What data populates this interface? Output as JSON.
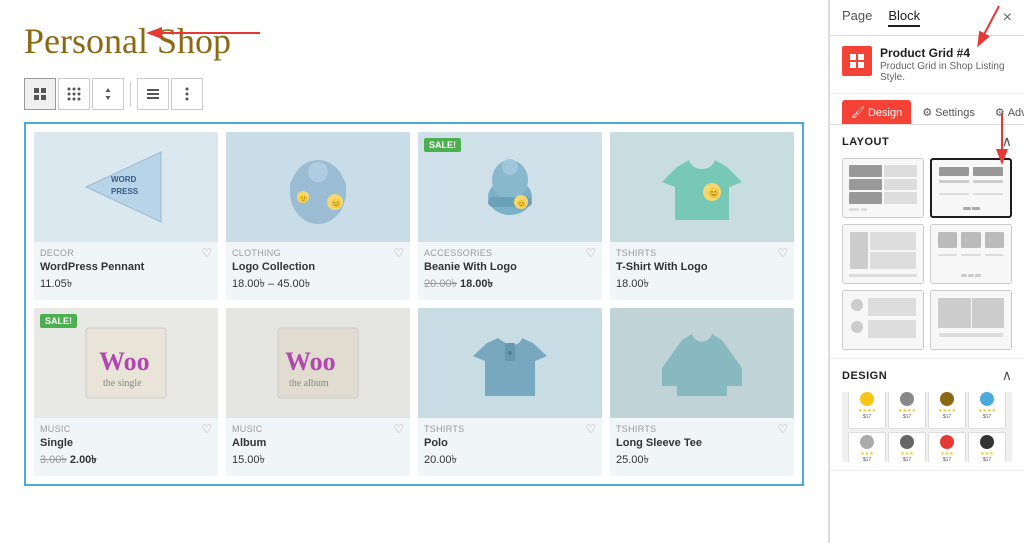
{
  "page": {
    "title": "Personal Shop",
    "panel_tabs": [
      {
        "id": "page",
        "label": "Page"
      },
      {
        "id": "block",
        "label": "Block",
        "active": true
      }
    ],
    "close_btn": "×"
  },
  "block_info": {
    "title": "Product Grid #4",
    "subtitle": "Product Grid in Shop Listing Style.",
    "icon": "🔴"
  },
  "action_tabs": [
    {
      "id": "design",
      "label": "Design",
      "icon": "🖌",
      "active": true
    },
    {
      "id": "settings",
      "label": "Settings",
      "icon": "⚙"
    },
    {
      "id": "advanced",
      "label": "Advanced",
      "icon": "⚙"
    }
  ],
  "toolbar": {
    "btns": [
      "⊞",
      "⠿",
      "↕",
      "≡",
      "⋮"
    ]
  },
  "layout": {
    "title": "Layout",
    "options": [
      {
        "id": 1,
        "selected": false
      },
      {
        "id": 2,
        "selected": true
      },
      {
        "id": 3,
        "selected": false
      },
      {
        "id": 4,
        "selected": false
      },
      {
        "id": 5,
        "selected": false
      },
      {
        "id": 6,
        "selected": false
      }
    ]
  },
  "design_section": {
    "title": "Design"
  },
  "products": [
    {
      "id": 1,
      "category": "DECOR",
      "name": "WordPress Pennant",
      "price": "11.05৳",
      "original_price": null,
      "sale": false,
      "color": "#dce8f0",
      "img_type": "pennant"
    },
    {
      "id": 2,
      "category": "CLOTHING",
      "name": "Logo Collection",
      "price": "18.00৳ – 45.00৳",
      "original_price": null,
      "sale": false,
      "color": "#c8dde8",
      "img_type": "hoodie"
    },
    {
      "id": 3,
      "category": "ACCESSORIES",
      "name": "Beanie With Logo",
      "price": "18.00৳",
      "original_price": "20.00৳",
      "sale": true,
      "color": "#d0e0e8",
      "img_type": "beanie"
    },
    {
      "id": 4,
      "category": "TSHIRTS",
      "name": "T-Shirt With Logo",
      "price": "18.00৳",
      "original_price": null,
      "sale": false,
      "color": "#c8dde0",
      "img_type": "tshirt_teal"
    },
    {
      "id": 5,
      "category": "MUSIC",
      "name": "Single",
      "price": "2.00৳",
      "original_price": "3.00৳",
      "sale": true,
      "color": "#e8e8e4",
      "img_type": "woo_single",
      "woo_text": "Woo",
      "woo_sub": "the single"
    },
    {
      "id": 6,
      "category": "MUSIC",
      "name": "Album",
      "price": "15.00৳",
      "original_price": null,
      "sale": false,
      "color": "#e4e4e0",
      "img_type": "woo_album",
      "woo_text": "Woo",
      "woo_sub": "the album"
    },
    {
      "id": 7,
      "category": "TSHIRTS",
      "name": "Polo",
      "price": "20.00৳",
      "original_price": null,
      "sale": false,
      "color": "#c8dce4",
      "img_type": "polo"
    },
    {
      "id": 8,
      "category": "TSHIRTS",
      "name": "Long Sleeve Tee",
      "price": "25.00৳",
      "original_price": null,
      "sale": false,
      "color": "#c0d4d8",
      "img_type": "longsleeve"
    }
  ]
}
